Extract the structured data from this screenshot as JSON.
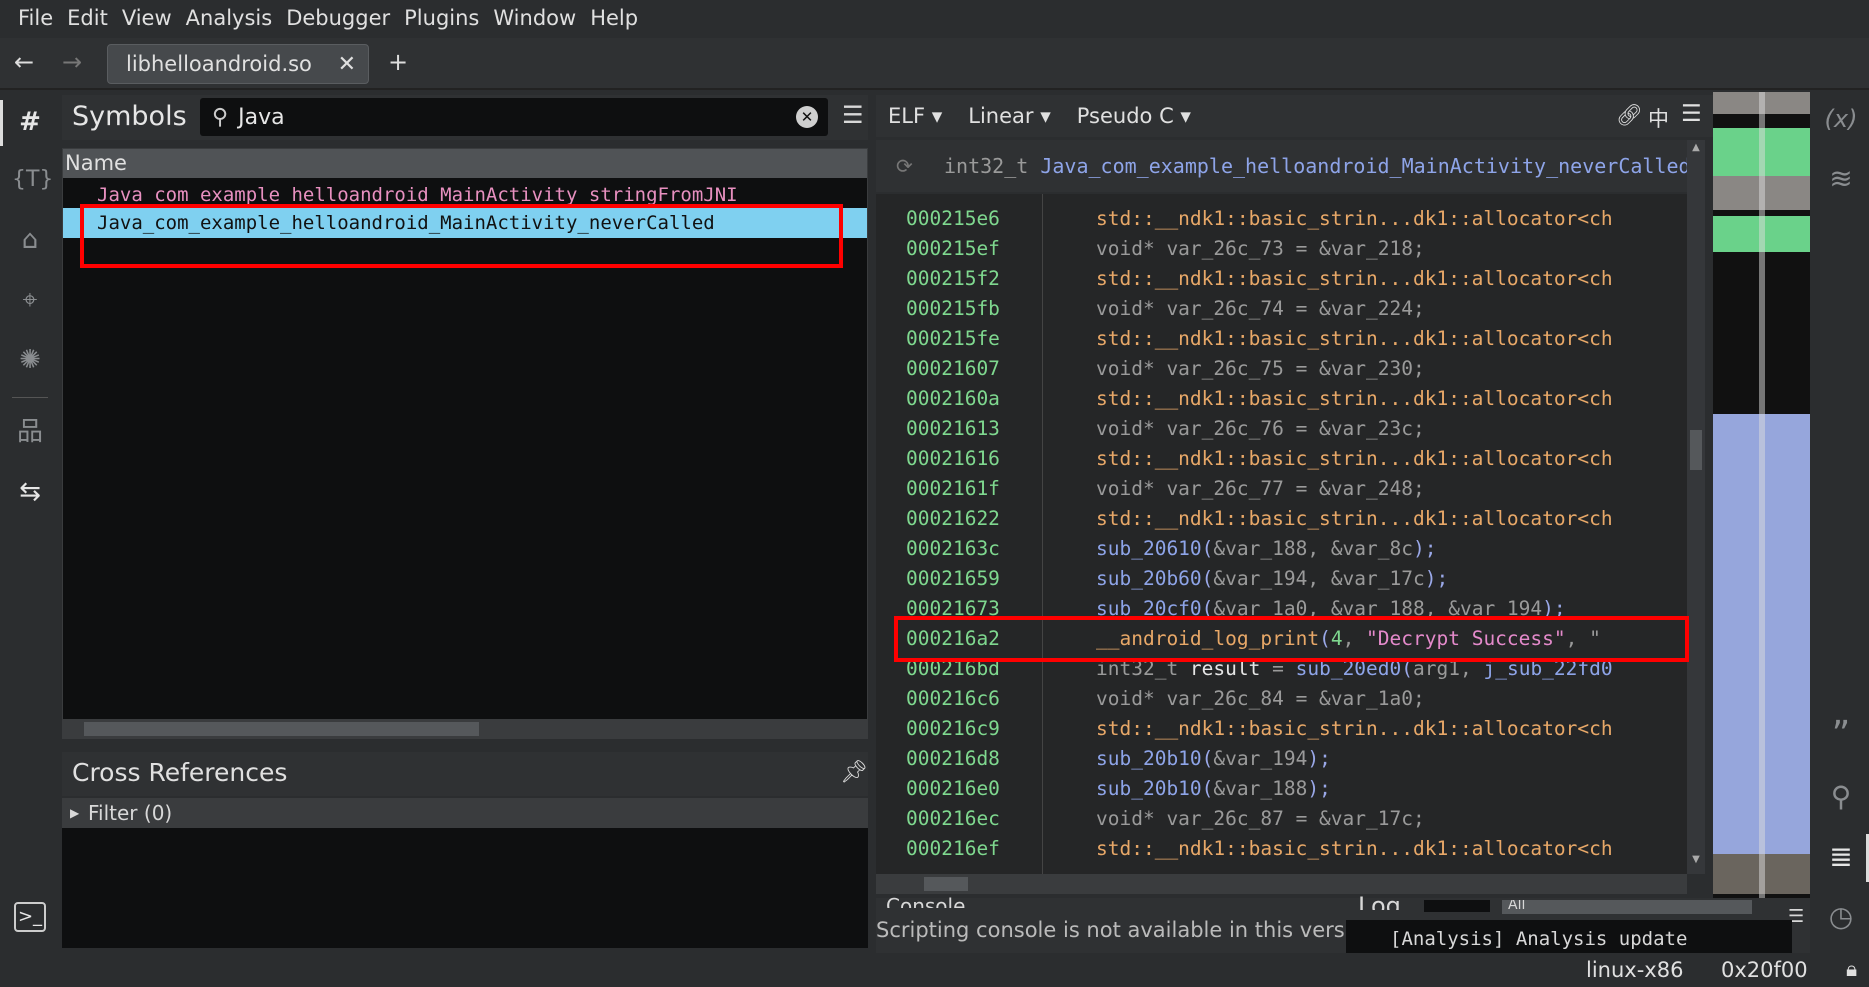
{
  "menu": [
    "File",
    "Edit",
    "View",
    "Analysis",
    "Debugger",
    "Plugins",
    "Window",
    "Help"
  ],
  "tab": {
    "title": "libhelloandroid.so",
    "close": "✕",
    "new": "+"
  },
  "symbols": {
    "title": "Symbols",
    "search_value": "Java",
    "column": "Name",
    "rows": [
      "Java_com_example_helloandroid_MainActivity_stringFromJNI",
      "Java_com_example_helloandroid_MainActivity_neverCalled"
    ],
    "selected_index": 1
  },
  "xrefs": {
    "title": "Cross References",
    "filter": "Filter (0)"
  },
  "code_toolbar": {
    "view": "ELF ▾",
    "mode": "Linear ▾",
    "lang": "Pseudo C ▾"
  },
  "function_header": {
    "ret": "int32_t",
    "name": "Java_com_example_helloandroid_MainActivity_neverCalled"
  },
  "code_lines": [
    {
      "addr": "000215e6",
      "seg": [
        [
          "std::__ndk1::basic_strin...dk1::allocator<ch",
          "orange"
        ]
      ]
    },
    {
      "addr": "000215ef",
      "seg": [
        [
          "void* var_26c_73 = &var_218;",
          "gray"
        ]
      ]
    },
    {
      "addr": "000215f2",
      "seg": [
        [
          "std::__ndk1::basic_strin...dk1::allocator<ch",
          "orange"
        ]
      ]
    },
    {
      "addr": "000215fb",
      "seg": [
        [
          "void* var_26c_74 = &var_224;",
          "gray"
        ]
      ]
    },
    {
      "addr": "000215fe",
      "seg": [
        [
          "std::__ndk1::basic_strin...dk1::allocator<ch",
          "orange"
        ]
      ]
    },
    {
      "addr": "00021607",
      "seg": [
        [
          "void* var_26c_75 = &var_230;",
          "gray"
        ]
      ]
    },
    {
      "addr": "0002160a",
      "seg": [
        [
          "std::__ndk1::basic_strin...dk1::allocator<ch",
          "orange"
        ]
      ]
    },
    {
      "addr": "00021613",
      "seg": [
        [
          "void* var_26c_76 = &var_23c;",
          "gray"
        ]
      ]
    },
    {
      "addr": "00021616",
      "seg": [
        [
          "std::__ndk1::basic_strin...dk1::allocator<ch",
          "orange"
        ]
      ]
    },
    {
      "addr": "0002161f",
      "seg": [
        [
          "void* var_26c_77 = &var_248;",
          "gray"
        ]
      ]
    },
    {
      "addr": "00021622",
      "seg": [
        [
          "std::__ndk1::basic_strin...dk1::allocator<ch",
          "orange"
        ]
      ]
    },
    {
      "addr": "0002163c",
      "seg": [
        [
          "sub_20610",
          "fn"
        ],
        [
          "(",
          "punc"
        ],
        [
          "&var_188, &var_8c",
          "gray"
        ],
        [
          ");",
          "punc"
        ]
      ]
    },
    {
      "addr": "00021659",
      "seg": [
        [
          "sub_20b60",
          "fn"
        ],
        [
          "(",
          "punc"
        ],
        [
          "&var_194, &var_17c",
          "gray"
        ],
        [
          ");",
          "punc"
        ]
      ]
    },
    {
      "addr": "00021673",
      "seg": [
        [
          "sub_20cf0",
          "fn"
        ],
        [
          "(",
          "punc"
        ],
        [
          "&var_1a0, &var_188, &var_194",
          "gray"
        ],
        [
          ");",
          "punc"
        ]
      ]
    },
    {
      "addr": "000216a2",
      "seg": [
        [
          "__android_log_print",
          "orange"
        ],
        [
          "(",
          "punc"
        ],
        [
          "4",
          "num"
        ],
        [
          ", ",
          "gray"
        ],
        [
          "\"Decrypt Success\"",
          "str"
        ],
        [
          ", \"",
          "gray"
        ]
      ]
    },
    {
      "addr": "000216bd",
      "seg": [
        [
          "int32_t ",
          "gray"
        ],
        [
          "result",
          "white"
        ],
        [
          " = ",
          "gray"
        ],
        [
          "sub_20ed0",
          "fn"
        ],
        [
          "(",
          "punc"
        ],
        [
          "arg1, ",
          "gray"
        ],
        [
          "j_sub_22fd0",
          "fn"
        ]
      ]
    },
    {
      "addr": "000216c6",
      "seg": [
        [
          "void* var_26c_84 = &var_1a0;",
          "gray"
        ]
      ]
    },
    {
      "addr": "000216c9",
      "seg": [
        [
          "std::__ndk1::basic_strin...dk1::allocator<ch",
          "orange"
        ]
      ]
    },
    {
      "addr": "000216d8",
      "seg": [
        [
          "sub_20b10",
          "fn"
        ],
        [
          "(",
          "punc"
        ],
        [
          "&var_194",
          "gray"
        ],
        [
          ");",
          "punc"
        ]
      ]
    },
    {
      "addr": "000216e0",
      "seg": [
        [
          "sub_20b10",
          "fn"
        ],
        [
          "(",
          "punc"
        ],
        [
          "&var_188",
          "gray"
        ],
        [
          ");",
          "punc"
        ]
      ]
    },
    {
      "addr": "000216ec",
      "seg": [
        [
          "void* var_26c_87 = &var_17c;",
          "gray"
        ]
      ]
    },
    {
      "addr": "000216ef",
      "seg": [
        [
          "std::__ndk1::basic_strin...dk1::allocator<ch",
          "orange"
        ]
      ]
    }
  ],
  "console": {
    "title": "Console",
    "message": "Scripting console is not available in this vers"
  },
  "log": {
    "title": "Log",
    "filter": "All",
    "message": "[Analysis] Analysis update"
  },
  "status": {
    "platform": "linux-x86",
    "address": "0x20f00"
  },
  "colors": {
    "address": "#7fd88f",
    "highlight": "#7fd0f0",
    "annotation": "#ff0000"
  }
}
